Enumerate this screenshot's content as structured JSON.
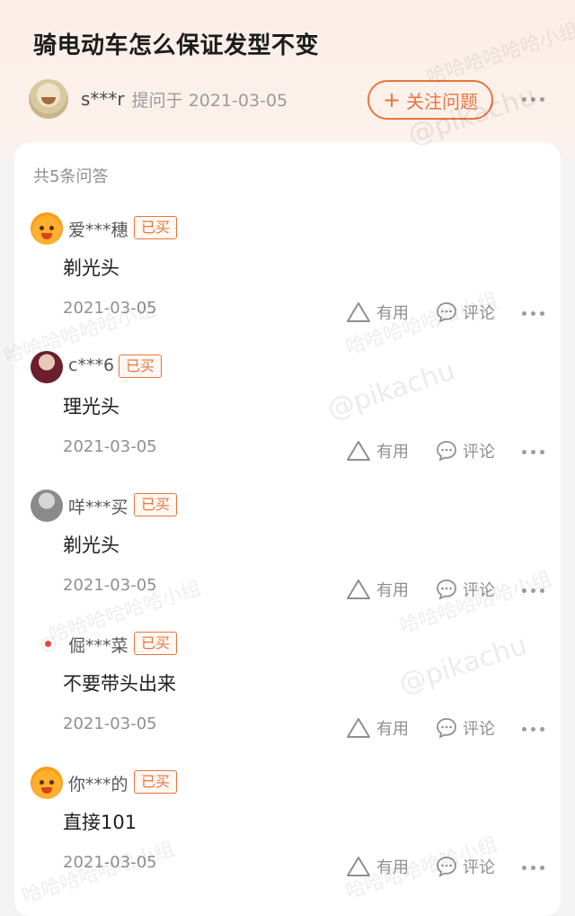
{
  "question": {
    "title": "骑电动车怎么保证发型不变",
    "asker_name": "s***r",
    "asked_meta": "提问于 2021-03-05",
    "follow_label": "关注问题",
    "follow_icon": "plus-icon"
  },
  "answers_count_label": "共5条问答",
  "answers": [
    {
      "name": "爱***穗",
      "tag": "已买",
      "text": "剃光头",
      "date": "2021-03-05",
      "useful_label": "有用",
      "comment_label": "评论"
    },
    {
      "name": "c***6",
      "tag": "已买",
      "text": "理光头",
      "date": "2021-03-05",
      "useful_label": "有用",
      "comment_label": "评论"
    },
    {
      "name": "咩***买",
      "tag": "已买",
      "text": "剃光头",
      "date": "2021-03-05",
      "useful_label": "有用",
      "comment_label": "评论"
    },
    {
      "name": "倔***菜",
      "tag": "已买",
      "text": "不要带头出来",
      "date": "2021-03-05",
      "useful_label": "有用",
      "comment_label": "评论"
    },
    {
      "name": "你***的",
      "tag": "已买",
      "text": "直接101",
      "date": "2021-03-05",
      "useful_label": "有用",
      "comment_label": "评论"
    }
  ],
  "watermarks": {
    "group_text": "哈哈哈哈哈哈小组",
    "handle_text": "@pikachu"
  },
  "colors": {
    "accent": "#e5763d",
    "title": "#1c1c1c",
    "muted": "#8f8f8f",
    "card_bg": "#ffffff"
  }
}
